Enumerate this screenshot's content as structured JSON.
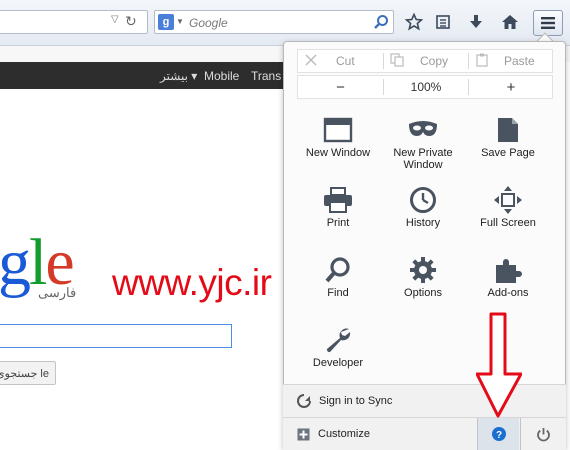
{
  "toolbar": {
    "search_placeholder": "Google",
    "search_engine_letter": "g"
  },
  "page": {
    "gbar": {
      "more": "بیشتر ▾",
      "mobile": "Mobile",
      "trans": "Trans"
    },
    "logo": {
      "g": "g",
      "l": "l",
      "e": "e"
    },
    "farsi": "فارسی",
    "watermark": "www.yjc.ir",
    "search_button": "جستجوی Google",
    "search_button_visible": "جستجوی le"
  },
  "menu": {
    "edit": {
      "cut": "Cut",
      "copy": "Copy",
      "paste": "Paste"
    },
    "zoom": {
      "minus": "−",
      "level": "100%",
      "plus": "+"
    },
    "tiles": [
      {
        "label": "New Window",
        "icon": "new-window-icon"
      },
      {
        "label": "New Private Window",
        "icon": "private-mask-icon"
      },
      {
        "label": "Save Page",
        "icon": "save-page-icon"
      },
      {
        "label": "Print",
        "icon": "printer-icon"
      },
      {
        "label": "History",
        "icon": "clock-icon"
      },
      {
        "label": "Full Screen",
        "icon": "fullscreen-icon"
      },
      {
        "label": "Find",
        "icon": "magnifier-icon"
      },
      {
        "label": "Options",
        "icon": "gear-icon"
      },
      {
        "label": "Add-ons",
        "icon": "puzzle-icon"
      },
      {
        "label": "Developer",
        "icon": "wrench-icon"
      }
    ],
    "sign_in": "Sign in to Sync",
    "customize": "Customize"
  },
  "colors": {
    "accent": "#1a6fd0",
    "annotation_arrow": "#e30b17",
    "watermark": "#e30b17"
  }
}
